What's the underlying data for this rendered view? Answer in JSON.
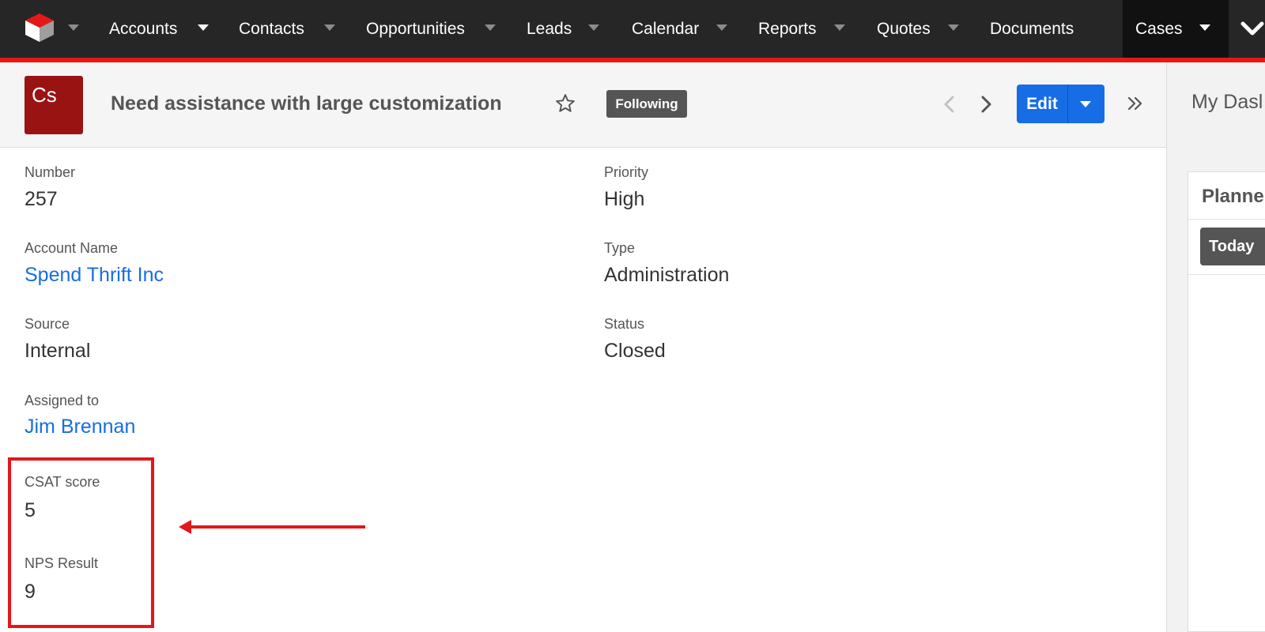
{
  "nav": {
    "items": [
      {
        "label": "Accounts"
      },
      {
        "label": "Contacts"
      },
      {
        "label": "Opportunities"
      },
      {
        "label": "Leads"
      },
      {
        "label": "Calendar"
      },
      {
        "label": "Reports"
      },
      {
        "label": "Quotes"
      },
      {
        "label": "Documents"
      },
      {
        "label": "Cases"
      }
    ],
    "active": "Cases",
    "accent_color": "#e61718"
  },
  "record": {
    "module_abbrev": "Cs",
    "title": "Need assistance with large customization",
    "following_label": "Following",
    "edit_label": "Edit"
  },
  "fields": {
    "number_label": "Number",
    "number_value": "257",
    "priority_label": "Priority",
    "priority_value": "High",
    "account_label": "Account Name",
    "account_value": "Spend Thrift Inc",
    "type_label": "Type",
    "type_value": "Administration",
    "source_label": "Source",
    "source_value": "Internal",
    "status_label": "Status",
    "status_value": "Closed",
    "assigned_label": "Assigned to",
    "assigned_value": "Jim Brennan",
    "csat_label": "CSAT score",
    "csat_value": "5",
    "nps_label": "NPS Result",
    "nps_value": "9"
  },
  "side": {
    "dashboard_title": "My Dasl",
    "planner_title": "Planne",
    "today_label": "Today"
  },
  "icons": {
    "logo": "cube-logo-icon",
    "star": "star-outline-icon",
    "prev": "chevron-left-icon",
    "next": "chevron-right-icon",
    "expand": "double-chevron-right-icon",
    "more": "chevron-down-icon"
  },
  "colors": {
    "link": "#176de5",
    "primary_button": "#176de5",
    "annotation": "#e3171b",
    "module_badge": "#9a1313"
  }
}
